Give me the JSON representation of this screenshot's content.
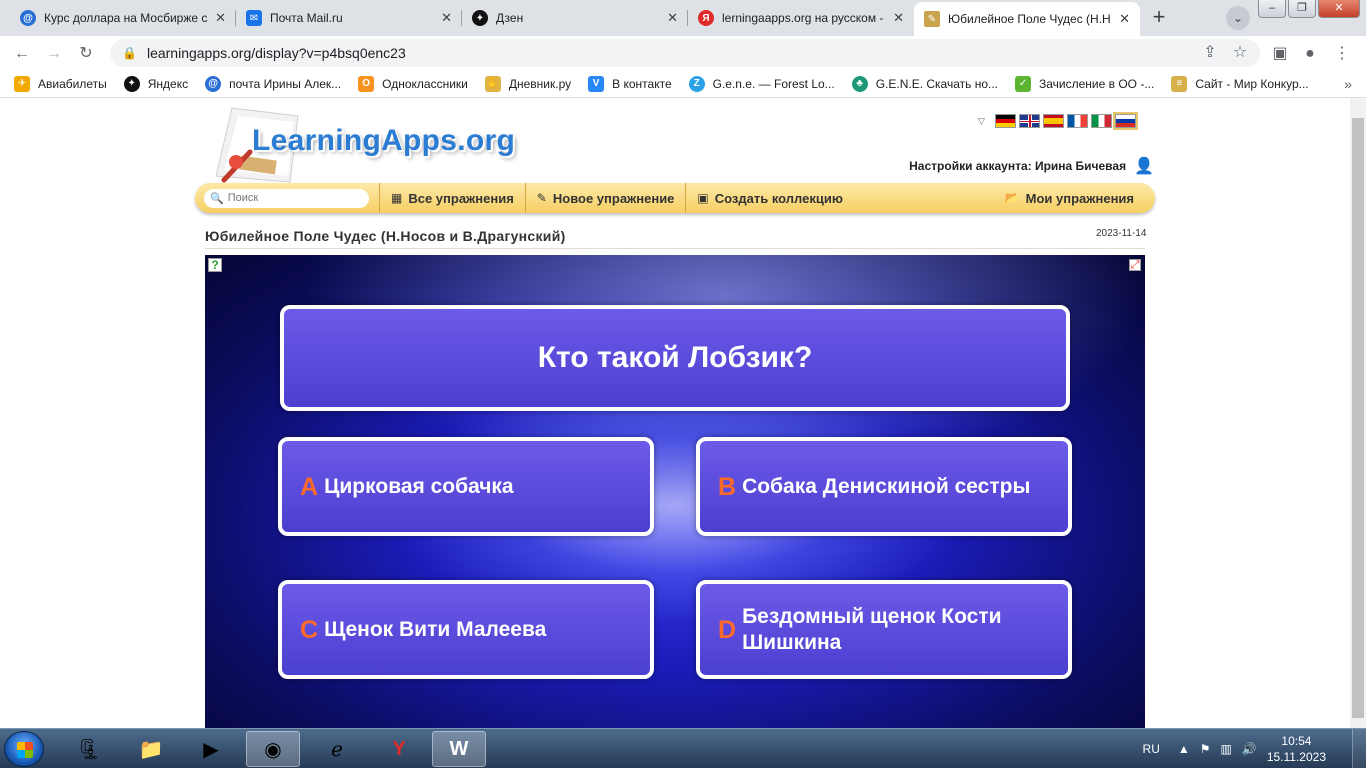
{
  "browser": {
    "tabs": [
      {
        "title": "Курс доллара на Мосбирже с",
        "icon": "at-icon",
        "color": "#2a6fd6"
      },
      {
        "title": "Почта Mail.ru",
        "icon": "mail-icon",
        "color": "#1a73e8"
      },
      {
        "title": "Дзен",
        "icon": "dzen-icon",
        "color": "#111111"
      },
      {
        "title": "lerningaapps.org на русском -",
        "icon": "yandex-icon",
        "color": "#e02b2b"
      },
      {
        "title": "Юбилейное Поле Чудес (Н.Н",
        "icon": "app-icon",
        "color": "#c9a44c"
      }
    ],
    "close_glyph": "✕",
    "new_tab_glyph": "+",
    "url": "learningapps.org/display?v=p4bsq0enc23",
    "bookmarks": [
      {
        "label": "Авиабилеты",
        "icon": "plane-icon",
        "color": "#f2a900"
      },
      {
        "label": "Яндекс",
        "icon": "yandex-star-icon",
        "color": "#111111"
      },
      {
        "label": "почта Ирины Алек...",
        "icon": "at-icon",
        "color": "#2a6fd6"
      },
      {
        "label": "Одноклассники",
        "icon": "ok-icon",
        "color": "#f7931e"
      },
      {
        "label": "Дневник.ру",
        "icon": "hand-icon",
        "color": "#e0b440"
      },
      {
        "label": "В контакте",
        "icon": "vk-icon",
        "color": "#2787f5"
      },
      {
        "label": "G.e.n.e. — Forest Lo...",
        "icon": "z-icon",
        "color": "#29a3e6"
      },
      {
        "label": "G.E.N.E. Скачать но...",
        "icon": "leaf-icon",
        "color": "#1e9a77"
      },
      {
        "label": "Зачисление в ОО -...",
        "icon": "check-icon",
        "color": "#5cb531"
      },
      {
        "label": "Сайт - Мир Конкур...",
        "icon": "book-icon",
        "color": "#d8b04a"
      }
    ],
    "more_glyph": "»"
  },
  "site": {
    "logo": "LearningApps.org",
    "account_label": "Настройки аккаунта: Ирина Бичевая",
    "search_placeholder": "Поиск",
    "nav": {
      "all": "Все упражнения",
      "new": "Новое упражнение",
      "collection": "Создать коллекцию",
      "mine": "Мои упражнения"
    },
    "app_title": "Юбилейное Поле Чудес (Н.Носов и В.Драгунский)",
    "app_date": "2023-11-14",
    "flag_colors": [
      "#000000",
      "#1f3a8f",
      "#c60b1e",
      "#0055a4",
      "#009246",
      "#ffffff"
    ]
  },
  "quiz": {
    "question": "Кто такой Лобзик?",
    "answers": [
      {
        "letter": "A",
        "text": "Цирковая собачка"
      },
      {
        "letter": "B",
        "text": "Собака Денискиной сестры"
      },
      {
        "letter": "C",
        "text": "Щенок Вити Малеева"
      },
      {
        "letter": "D",
        "text": "Бездомный щенок Кости Шишкина"
      }
    ],
    "accent_color": "#ff6a2a"
  },
  "taskbar": {
    "lang": "RU",
    "time": "10:54",
    "date": "15.11.2023"
  }
}
